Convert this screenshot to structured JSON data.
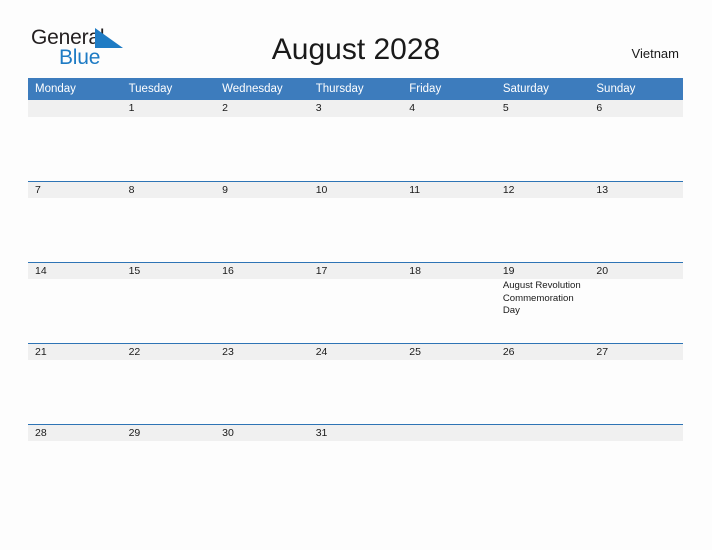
{
  "brand": {
    "name_part1": "General",
    "name_part2": "Blue",
    "flag_icon": "blue-triangle-flag-icon",
    "color_primary": "#231f20",
    "color_accent": "#1e7bc4"
  },
  "header": {
    "title": "August 2028",
    "country": "Vietnam"
  },
  "calendar": {
    "header_bg": "#3d7cbd",
    "band_bg": "#f0f0f0",
    "band_border": "#2e74b5",
    "weekday_headers": [
      "Monday",
      "Tuesday",
      "Wednesday",
      "Thursday",
      "Friday",
      "Saturday",
      "Sunday"
    ],
    "weeks": [
      [
        {
          "day": "",
          "events": []
        },
        {
          "day": "1",
          "events": []
        },
        {
          "day": "2",
          "events": []
        },
        {
          "day": "3",
          "events": []
        },
        {
          "day": "4",
          "events": []
        },
        {
          "day": "5",
          "events": []
        },
        {
          "day": "6",
          "events": []
        }
      ],
      [
        {
          "day": "7",
          "events": []
        },
        {
          "day": "8",
          "events": []
        },
        {
          "day": "9",
          "events": []
        },
        {
          "day": "10",
          "events": []
        },
        {
          "day": "11",
          "events": []
        },
        {
          "day": "12",
          "events": []
        },
        {
          "day": "13",
          "events": []
        }
      ],
      [
        {
          "day": "14",
          "events": []
        },
        {
          "day": "15",
          "events": []
        },
        {
          "day": "16",
          "events": []
        },
        {
          "day": "17",
          "events": []
        },
        {
          "day": "18",
          "events": []
        },
        {
          "day": "19",
          "events": [
            "August Revolution Commemoration Day"
          ]
        },
        {
          "day": "20",
          "events": []
        }
      ],
      [
        {
          "day": "21",
          "events": []
        },
        {
          "day": "22",
          "events": []
        },
        {
          "day": "23",
          "events": []
        },
        {
          "day": "24",
          "events": []
        },
        {
          "day": "25",
          "events": []
        },
        {
          "day": "26",
          "events": []
        },
        {
          "day": "27",
          "events": []
        }
      ],
      [
        {
          "day": "28",
          "events": []
        },
        {
          "day": "29",
          "events": []
        },
        {
          "day": "30",
          "events": []
        },
        {
          "day": "31",
          "events": []
        },
        {
          "day": "",
          "events": []
        },
        {
          "day": "",
          "events": []
        },
        {
          "day": "",
          "events": []
        }
      ]
    ]
  }
}
